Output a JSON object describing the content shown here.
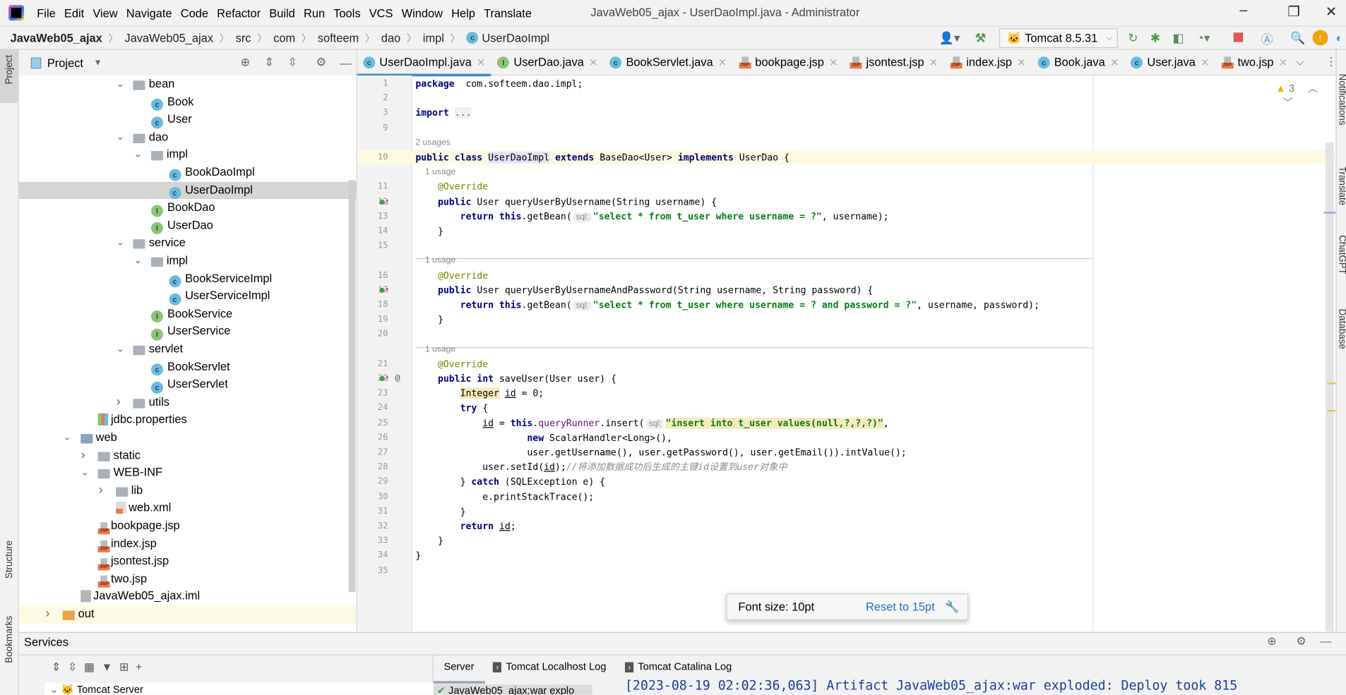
{
  "window": {
    "title": "JavaWeb05_ajax - UserDaoImpl.java - Administrator",
    "menu": [
      "File",
      "Edit",
      "View",
      "Navigate",
      "Code",
      "Refactor",
      "Build",
      "Run",
      "Tools",
      "VCS",
      "Window",
      "Help",
      "Translate"
    ],
    "controls": {
      "minimize": "–",
      "maximize": "❐",
      "close": "✕"
    }
  },
  "breadcrumb": [
    "JavaWeb05_ajax",
    "JavaWeb05_ajax",
    "src",
    "com",
    "softeem",
    "dao",
    "impl",
    "UserDaoImpl"
  ],
  "toolbar": {
    "run_config": "Tomcat 8.5.31"
  },
  "left_strip": {
    "project": "Project",
    "structure": "Structure",
    "bookmarks": "Bookmarks"
  },
  "right_strip": {
    "notifications": "Notifications",
    "translate": "Translate",
    "chatgpt": "ChatGPT",
    "database": "Database"
  },
  "project": {
    "title": "Project",
    "tree": [
      {
        "label": "bean",
        "icon": "folder",
        "d": 0,
        "arrow": "open"
      },
      {
        "label": "Book",
        "icon": "class",
        "d": 1
      },
      {
        "label": "User",
        "icon": "class",
        "d": 1
      },
      {
        "label": "dao",
        "icon": "folder",
        "d": 0,
        "arrow": "open"
      },
      {
        "label": "impl",
        "icon": "folder",
        "d": 1,
        "arrow": "open"
      },
      {
        "label": "BookDaoImpl",
        "icon": "class",
        "d": 2
      },
      {
        "label": "UserDaoImpl",
        "icon": "class",
        "d": 2,
        "selected": true
      },
      {
        "label": "BookDao",
        "icon": "interface",
        "d": 1
      },
      {
        "label": "UserDao",
        "icon": "interface",
        "d": 1
      },
      {
        "label": "service",
        "icon": "folder",
        "d": 0,
        "arrow": "open"
      },
      {
        "label": "impl",
        "icon": "folder",
        "d": 1,
        "arrow": "open"
      },
      {
        "label": "BookServiceImpl",
        "icon": "class",
        "d": 2
      },
      {
        "label": "UserServiceImpl",
        "icon": "class",
        "d": 2
      },
      {
        "label": "BookService",
        "icon": "interface",
        "d": 1
      },
      {
        "label": "UserService",
        "icon": "interface",
        "d": 1
      },
      {
        "label": "servlet",
        "icon": "folder",
        "d": 0,
        "arrow": "open"
      },
      {
        "label": "BookServlet",
        "icon": "class",
        "d": 1
      },
      {
        "label": "UserServlet",
        "icon": "class",
        "d": 1
      },
      {
        "label": "utils",
        "icon": "folder",
        "d": 0,
        "arrow": "closed"
      },
      {
        "label": "jdbc.properties",
        "icon": "props",
        "d": -2
      },
      {
        "label": "web",
        "icon": "web",
        "d": -3,
        "arrow": "open"
      },
      {
        "label": "static",
        "icon": "folder",
        "d": -2,
        "arrow": "closed"
      },
      {
        "label": "WEB-INF",
        "icon": "folder",
        "d": -2,
        "arrow": "open"
      },
      {
        "label": "lib",
        "icon": "folder",
        "d": -1,
        "arrow": "closed"
      },
      {
        "label": "web.xml",
        "icon": "xml",
        "d": -1
      },
      {
        "label": "bookpage.jsp",
        "icon": "jsp",
        "d": -2
      },
      {
        "label": "index.jsp",
        "icon": "jsp",
        "d": -2
      },
      {
        "label": "jsontest.jsp",
        "icon": "jsp",
        "d": -2
      },
      {
        "label": "two.jsp",
        "icon": "jsp",
        "d": -2
      },
      {
        "label": "JavaWeb05_ajax.iml",
        "icon": "iml",
        "d": -3
      },
      {
        "label": "out",
        "icon": "out",
        "d": -4,
        "arrow": "closed",
        "highlight": true
      }
    ]
  },
  "tabs": [
    {
      "label": "UserDaoImpl.java",
      "icon": "class",
      "active": true
    },
    {
      "label": "UserDao.java",
      "icon": "interface"
    },
    {
      "label": "BookServlet.java",
      "icon": "class"
    },
    {
      "label": "bookpage.jsp",
      "icon": "jsp"
    },
    {
      "label": "jsontest.jsp",
      "icon": "jsp"
    },
    {
      "label": "index.jsp",
      "icon": "jsp"
    },
    {
      "label": "Book.java",
      "icon": "class"
    },
    {
      "label": "User.java",
      "icon": "class"
    },
    {
      "label": "two.jsp",
      "icon": "jsp"
    }
  ],
  "inspections": {
    "warnings": "3"
  },
  "code": [
    {
      "n": "1",
      "t": [
        [
          "kw",
          "package"
        ],
        [
          "",
          "  com.softeem.dao.impl;"
        ]
      ]
    },
    {
      "n": "2",
      "t": []
    },
    {
      "n": "3",
      "t": [
        [
          "kw",
          "import"
        ],
        [
          "",
          " "
        ],
        [
          "hl-imp",
          "..."
        ]
      ]
    },
    {
      "n": "9",
      "t": []
    },
    {
      "inlay": "2 usages"
    },
    {
      "n": "10",
      "cur": true,
      "t": [
        [
          "kw",
          "public class"
        ],
        [
          "",
          " "
        ],
        [
          "hl-sel",
          "UserDaoImpl"
        ],
        [
          "",
          " "
        ],
        [
          "kw",
          "extends"
        ],
        [
          "",
          " BaseDao<User> "
        ],
        [
          "kw",
          "implements"
        ],
        [
          "",
          " UserDao {"
        ]
      ]
    },
    {
      "inlay": "    1 usage"
    },
    {
      "n": "11",
      "t": [
        [
          "",
          "    "
        ],
        [
          "ann",
          "@Override"
        ]
      ]
    },
    {
      "n": "12",
      "mark": "impl",
      "t": [
        [
          "",
          "    "
        ],
        [
          "kw",
          "public"
        ],
        [
          "",
          " User queryUserByUsername(String username) {"
        ]
      ]
    },
    {
      "n": "13",
      "t": [
        [
          "",
          "        "
        ],
        [
          "kw",
          "return this"
        ],
        [
          "",
          ".getBean("
        ],
        [
          "hint",
          "sql:"
        ],
        [
          "str",
          "\"select * from t_user where username = ?\""
        ],
        [
          "",
          ", username);"
        ]
      ]
    },
    {
      "n": "14",
      "t": [
        [
          "",
          "    }"
        ]
      ]
    },
    {
      "n": "15",
      "t": [],
      "sep": true
    },
    {
      "inlay": "    1 usage"
    },
    {
      "n": "16",
      "t": [
        [
          "",
          "    "
        ],
        [
          "ann",
          "@Override"
        ]
      ]
    },
    {
      "n": "17",
      "mark": "impl",
      "t": [
        [
          "",
          "    "
        ],
        [
          "kw",
          "public"
        ],
        [
          "",
          " User queryUserByUsernameAndPassword(String username, String password) {"
        ]
      ]
    },
    {
      "n": "18",
      "t": [
        [
          "",
          "        "
        ],
        [
          "kw",
          "return this"
        ],
        [
          "",
          ".getBean("
        ],
        [
          "hint",
          "sql:"
        ],
        [
          "str",
          "\"select * from t_user where username = ? and password = ?\""
        ],
        [
          "",
          ", username, password);"
        ]
      ]
    },
    {
      "n": "19",
      "t": [
        [
          "",
          "    }"
        ]
      ]
    },
    {
      "n": "20",
      "t": [],
      "sep": true
    },
    {
      "inlay": "    1 usage"
    },
    {
      "n": "21",
      "t": [
        [
          "",
          "    "
        ],
        [
          "ann",
          "@Override"
        ]
      ]
    },
    {
      "n": "22",
      "mark": "impl-at",
      "t": [
        [
          "",
          "    "
        ],
        [
          "kw",
          "public int"
        ],
        [
          "",
          " saveUser(User user) {"
        ]
      ]
    },
    {
      "n": "23",
      "t": [
        [
          "",
          "        "
        ],
        [
          "hl-y",
          "Integer"
        ],
        [
          "",
          " "
        ],
        [
          "und",
          "id"
        ],
        [
          "",
          " = 0;"
        ]
      ]
    },
    {
      "n": "24",
      "t": [
        [
          "",
          "        "
        ],
        [
          "kw",
          "try"
        ],
        [
          "",
          " {"
        ]
      ]
    },
    {
      "n": "25",
      "t": [
        [
          "",
          "            "
        ],
        [
          "und",
          "id"
        ],
        [
          "",
          " = "
        ],
        [
          "kw",
          "this"
        ],
        [
          "",
          "."
        ],
        [
          "fld",
          "queryRunner"
        ],
        [
          "",
          ".insert("
        ],
        [
          "hint",
          "sql:"
        ],
        [
          "str hl-y",
          "\"insert into t_user values(null,?,?,?)\""
        ],
        [
          "",
          ","
        ]
      ]
    },
    {
      "n": "26",
      "t": [
        [
          "",
          "                    "
        ],
        [
          "kw",
          "new"
        ],
        [
          "",
          " ScalarHandler<Long>(),"
        ]
      ]
    },
    {
      "n": "27",
      "t": [
        [
          "",
          "                    user.getUsername(), user.getPassword(), user.getEmail()).intValue();"
        ]
      ]
    },
    {
      "n": "28",
      "t": [
        [
          "",
          "            user.setId("
        ],
        [
          "und",
          "id"
        ],
        [
          "",
          ");"
        ],
        [
          "cmt",
          "//将添加数据成功后生成的主键id设置到user对象中"
        ]
      ]
    },
    {
      "n": "29",
      "t": [
        [
          "",
          "        } "
        ],
        [
          "kw",
          "catch"
        ],
        [
          "",
          " (SQLException e) {"
        ]
      ]
    },
    {
      "n": "30",
      "t": [
        [
          "",
          "            e.printStackTrace();"
        ]
      ]
    },
    {
      "n": "31",
      "t": [
        [
          "",
          "        }"
        ]
      ]
    },
    {
      "n": "32",
      "t": [
        [
          "",
          "        "
        ],
        [
          "kw",
          "return"
        ],
        [
          "",
          " "
        ],
        [
          "und",
          "id"
        ],
        [
          "",
          ";"
        ]
      ]
    },
    {
      "n": "33",
      "t": [
        [
          "",
          "    }"
        ]
      ]
    },
    {
      "n": "34",
      "t": [
        [
          "",
          "}"
        ]
      ]
    },
    {
      "n": "35",
      "t": []
    }
  ],
  "font_popup": {
    "label": "Font size: 10pt",
    "reset": "Reset to 15pt"
  },
  "services": {
    "title": "Services",
    "tabs": [
      "Server",
      "Tomcat Localhost Log",
      "Tomcat Catalina Log"
    ],
    "tree_item": "Tomcat Server",
    "deployment": "JavaWeb05_ajax:war explo",
    "console": "[2023-08-19 02:02:36,063] Artifact JavaWeb05_ajax:war exploded: Deploy took 815"
  }
}
